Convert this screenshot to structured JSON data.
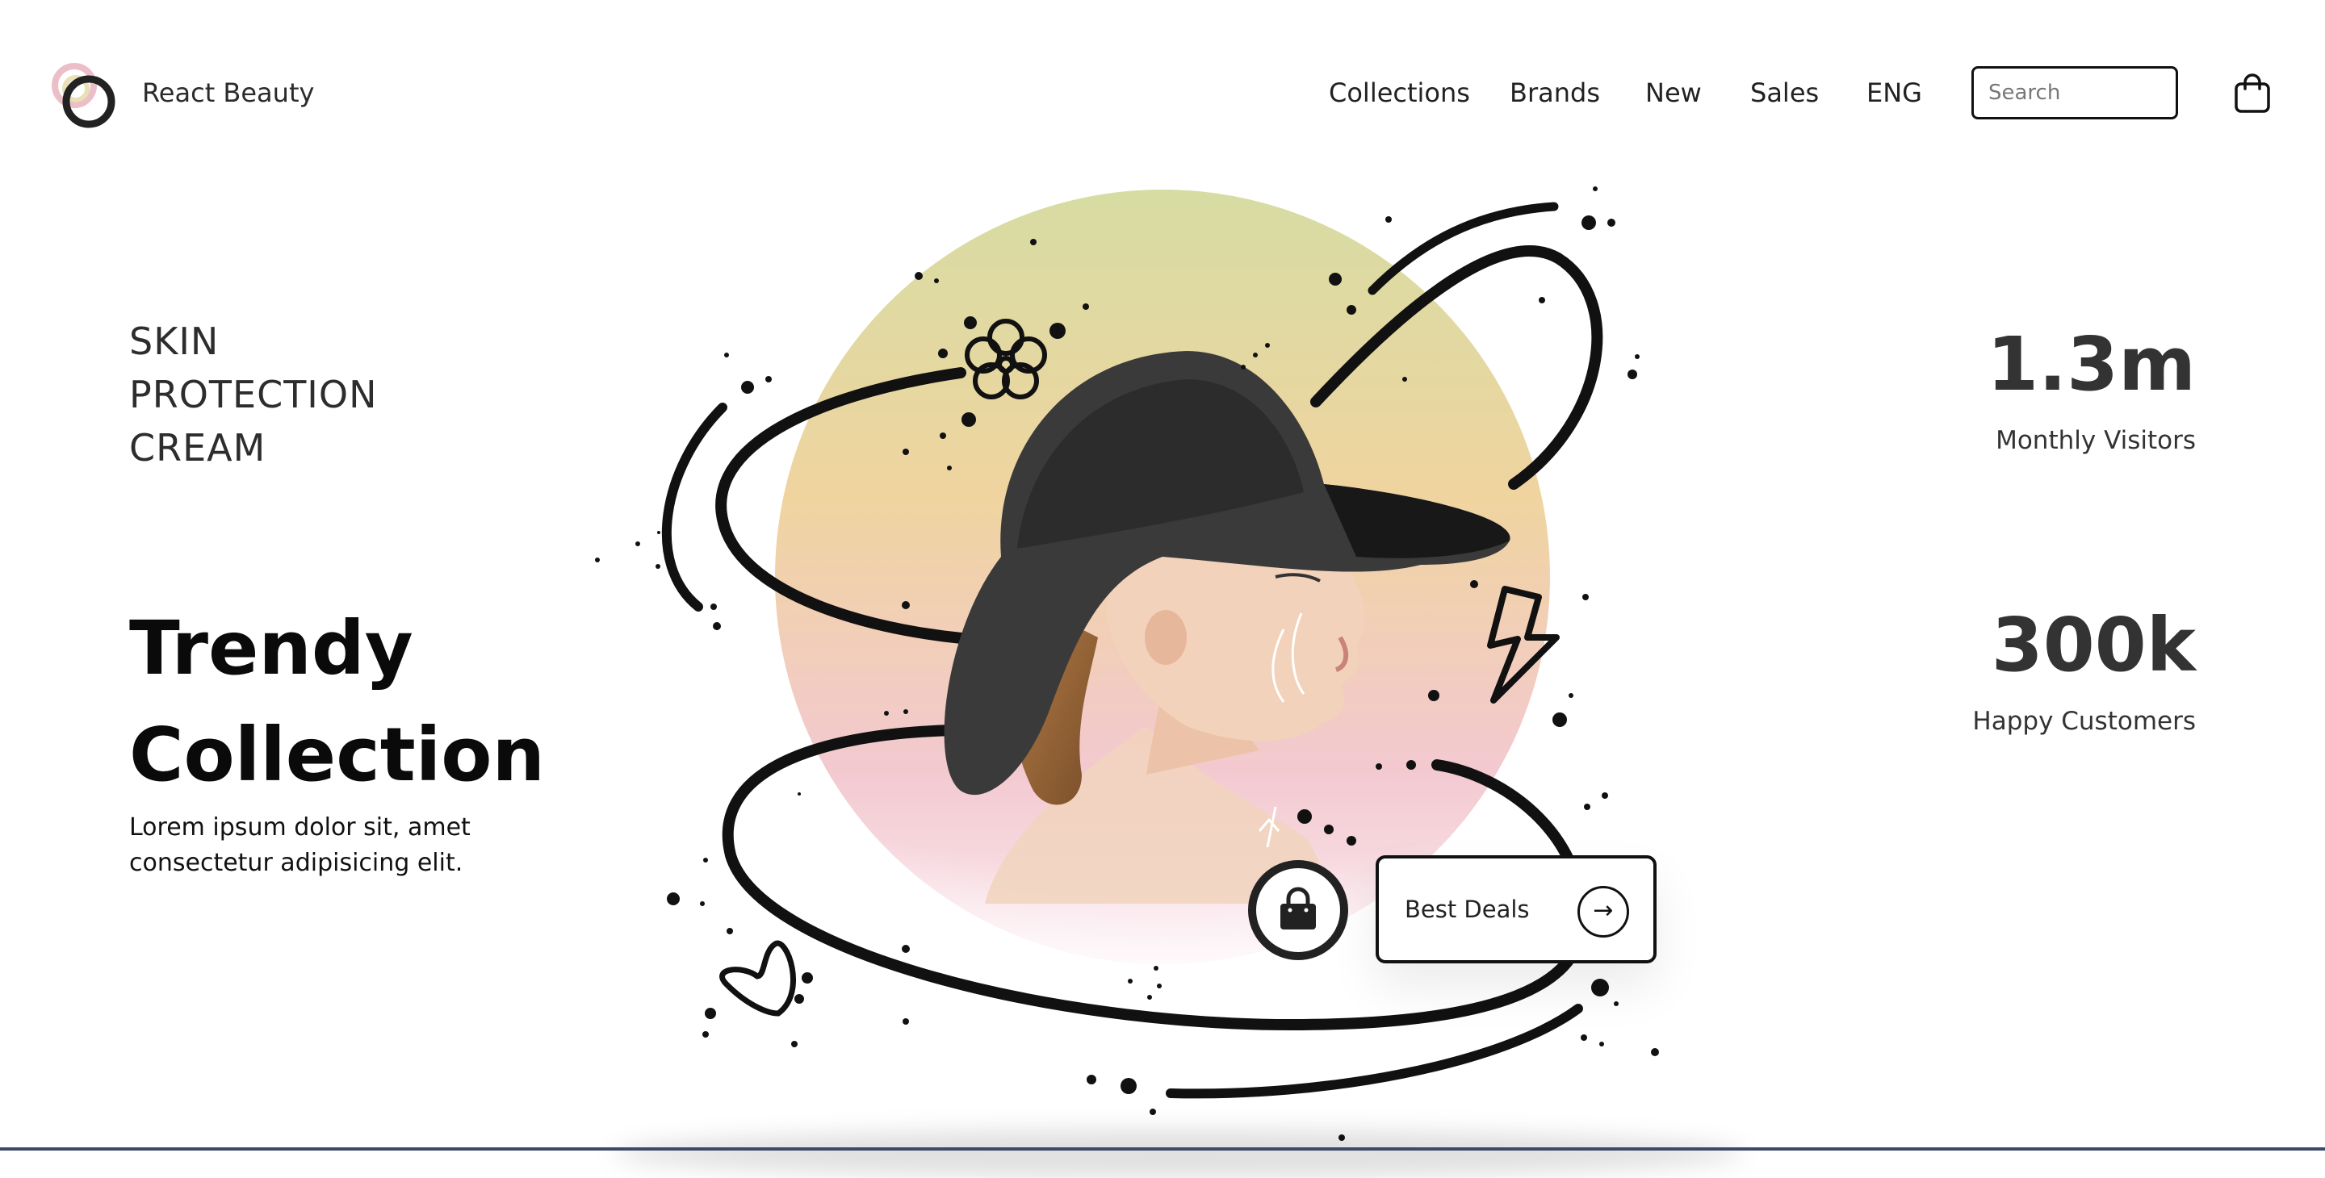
{
  "brand": {
    "name": "React Beauty"
  },
  "nav": {
    "items": [
      "Collections",
      "Brands",
      "New",
      "Sales",
      "ENG"
    ],
    "search_placeholder": "Search",
    "cart_icon": "shopping-bag-icon"
  },
  "hero": {
    "tagline": [
      "SKIN",
      "PROTECTION",
      "CREAM"
    ],
    "title_lines": [
      "Trendy",
      "Collection"
    ],
    "description": "Lorem ipsum dolor sit, amet consectetur adipisicing elit."
  },
  "stats": [
    {
      "value": "1.3m",
      "label": "Monthly Visitors"
    },
    {
      "value": "300k",
      "label": "Happy Customers"
    }
  ],
  "deals": {
    "label": "Best Deals",
    "arrow": "→",
    "icon": "bag-icon"
  },
  "colors": {
    "circle_top": "#d6dca3",
    "circle_mid": "#f0d4a0",
    "circle_bottom": "#f3c9d0",
    "text_dark": "#222222"
  }
}
